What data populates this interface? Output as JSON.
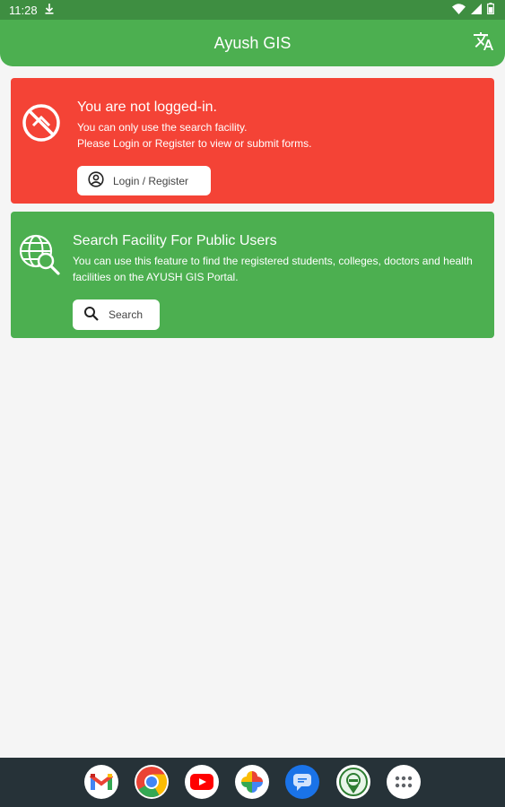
{
  "status_bar": {
    "time": "11:28",
    "download_icon": "download-icon",
    "wifi_icon": "wifi-icon",
    "signal_icon": "signal-icon",
    "battery_icon": "battery-icon"
  },
  "app_bar": {
    "title": "Ayush GIS",
    "translate_icon": "translate-icon"
  },
  "login_card": {
    "icon": "no-entry-icon",
    "title": "You are not logged-in.",
    "line1": "You can only use the search facility.",
    "line2": "Please Login or Register to view or submit forms.",
    "button_label": "Login / Register",
    "button_icon": "account-circle-icon",
    "color": "#f44336"
  },
  "search_card": {
    "icon": "globe-search-icon",
    "title": "Search Facility For Public Users",
    "text": "You can use this feature to find the registered students, colleges, doctors and health facilities on the AYUSH GIS Portal.",
    "button_label": "Search",
    "button_icon": "search-icon",
    "color": "#4caf50"
  },
  "dock": {
    "apps": [
      "gmail-icon",
      "chrome-icon",
      "youtube-icon",
      "photos-icon",
      "messages-icon",
      "ayush-app-icon",
      "app-drawer-icon"
    ]
  }
}
